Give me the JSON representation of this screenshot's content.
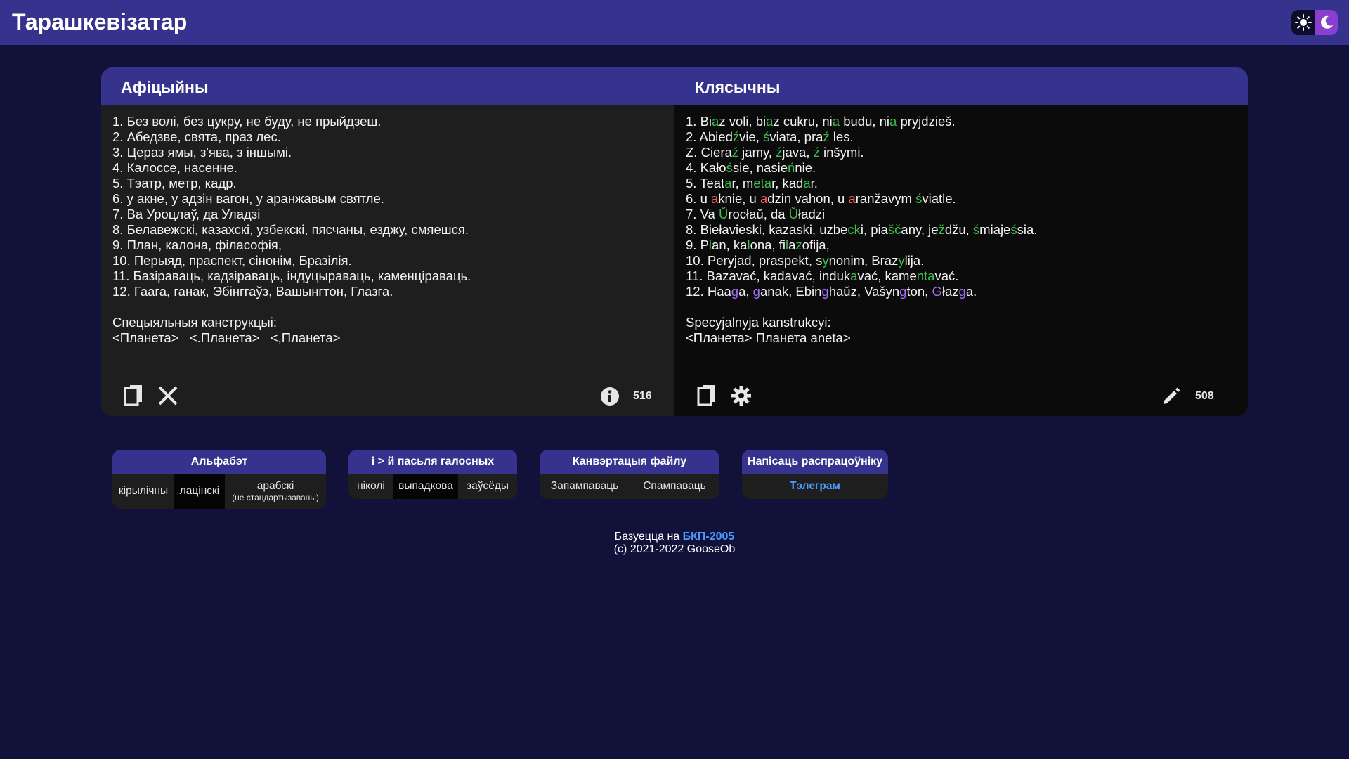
{
  "header": {
    "title": "Тарашкевізатар",
    "theme_toggle_icons": [
      "sun-icon",
      "moon-icon"
    ]
  },
  "official": {
    "title": "Афіцыйны",
    "lines": [
      "1. Без волі, без цукру, не буду, не прыйдзеш.",
      "2. Абедзве, свята, праз лес.",
      "3. Цераз ямы, з'ява, з іншымі.",
      "4. Калоссе, насенне.",
      "5. Тэатр, метр, кадр.",
      "6. у акне, у адзін вагон, у аранжавым святле.",
      "7. Ва Уроцлаў, да Уладзі",
      "8. Белавежскі, казахскі, узбекскі, пясчаны, езджу, смяешся.",
      "9. План, калона, філасофія,",
      "10. Перыяд, праспект, сінонім, Бразілія.",
      "11. Базіраваць, кадзіраваць, індуцыраваць, каменціраваць.",
      "12. Гаага, ганак, Эбінггаўз, Вашынгтон, Глазга.",
      "",
      "Спецыяльныя канструкцыі:",
      "<Планета>   <.Планета>   <,Планета>"
    ],
    "count": "516"
  },
  "classic": {
    "title": "Клясычны",
    "lines": [
      [
        [
          "1. Bi",
          ""
        ],
        [
          "a",
          "g"
        ],
        [
          "z voli, bi",
          ""
        ],
        [
          "a",
          "g"
        ],
        [
          "z cukru, ni",
          ""
        ],
        [
          "a",
          "g"
        ],
        [
          " budu, ni",
          ""
        ],
        [
          "a",
          "g"
        ],
        [
          " pryjdzieš.",
          ""
        ]
      ],
      [
        [
          "2. Abied",
          ""
        ],
        [
          "ź",
          "g"
        ],
        [
          "vie, ",
          ""
        ],
        [
          "ś",
          "g"
        ],
        [
          "viata, pra",
          ""
        ],
        [
          "ź",
          "g"
        ],
        [
          " les.",
          ""
        ]
      ],
      [
        [
          "Z. Ciera",
          ""
        ],
        [
          "ź",
          "g"
        ],
        [
          " jamy, ",
          ""
        ],
        [
          "ź",
          "g"
        ],
        [
          "java, ",
          ""
        ],
        [
          "ź",
          "g"
        ],
        [
          " inšymi.",
          ""
        ]
      ],
      [
        [
          "4. Kało",
          ""
        ],
        [
          "ś",
          "g"
        ],
        [
          "sie, nasie",
          ""
        ],
        [
          "ń",
          "g"
        ],
        [
          "nie.",
          ""
        ]
      ],
      [
        [
          "5. Teat",
          ""
        ],
        [
          "a",
          "g"
        ],
        [
          "r, m",
          ""
        ],
        [
          "eta",
          "g"
        ],
        [
          "r, kad",
          ""
        ],
        [
          "a",
          "g"
        ],
        [
          "r.",
          ""
        ]
      ],
      [
        [
          "6. u ",
          ""
        ],
        [
          "a",
          "r"
        ],
        [
          "knie, u ",
          ""
        ],
        [
          "a",
          "r"
        ],
        [
          "dzin vahon, u ",
          ""
        ],
        [
          "a",
          "r"
        ],
        [
          "ranžavym ",
          ""
        ],
        [
          "ś",
          "g"
        ],
        [
          "viatle.",
          ""
        ]
      ],
      [
        [
          "7. Va ",
          ""
        ],
        [
          "Ŭ",
          "g"
        ],
        [
          "rocłaŭ, da ",
          ""
        ],
        [
          "Ŭ",
          "g"
        ],
        [
          "ładzi",
          ""
        ]
      ],
      [
        [
          "8. Biełavieski, kazaski, uzbe",
          ""
        ],
        [
          "ck",
          "g"
        ],
        [
          "i, pia",
          ""
        ],
        [
          "šč",
          "g"
        ],
        [
          "any, je",
          ""
        ],
        [
          "ž",
          "g"
        ],
        [
          "džu, ",
          ""
        ],
        [
          "ś",
          "g"
        ],
        [
          "miaje",
          ""
        ],
        [
          "ś",
          "g"
        ],
        [
          "sia.",
          ""
        ]
      ],
      [
        [
          "9. P",
          ""
        ],
        [
          "l",
          "g"
        ],
        [
          "an, ka",
          ""
        ],
        [
          "l",
          "g"
        ],
        [
          "ona, fi",
          ""
        ],
        [
          "l",
          "g"
        ],
        [
          "a",
          ""
        ],
        [
          "z",
          "g"
        ],
        [
          "ofija,",
          ""
        ]
      ],
      [
        [
          "10. Peryjad, praspekt, s",
          ""
        ],
        [
          "y",
          "g"
        ],
        [
          "nonim, Braz",
          ""
        ],
        [
          "y",
          "g"
        ],
        [
          "lija.",
          ""
        ]
      ],
      [
        [
          "11. Bazavać, kadavać, induk",
          ""
        ],
        [
          "a",
          "g"
        ],
        [
          "vać, kame",
          ""
        ],
        [
          "nta",
          "g"
        ],
        [
          "vać.",
          ""
        ]
      ],
      [
        [
          "12. Haa",
          ""
        ],
        [
          "g",
          "p"
        ],
        [
          "a, ",
          ""
        ],
        [
          "g",
          "p"
        ],
        [
          "anak, Ebin",
          ""
        ],
        [
          "g",
          "p"
        ],
        [
          "haŭz, Vašyn",
          ""
        ],
        [
          "g",
          "p"
        ],
        [
          "ton, ",
          ""
        ],
        [
          "G",
          "p"
        ],
        [
          "łaz",
          ""
        ],
        [
          "g",
          "p"
        ],
        [
          "a.",
          ""
        ]
      ],
      [
        [
          "",
          ""
        ]
      ],
      [
        [
          "Specyjalnyja kanstrukcyi:",
          ""
        ]
      ],
      [
        [
          "<Планета> Планета aneta>",
          ""
        ]
      ]
    ],
    "count": "508"
  },
  "options": {
    "alphabet": {
      "title": "Альфабэт",
      "items": [
        "кірылічны",
        "лацінскі"
      ],
      "arabic": "арабскі",
      "arabic_note": "(не стандартызаваны)",
      "selected": "лацінскі"
    },
    "i_to_j": {
      "title": "і > й пасьля галосных",
      "items": [
        "ніколі",
        "выпадкова",
        "заўсёды"
      ],
      "selected": "выпадкова"
    },
    "file_conv": {
      "title": "Канвэртацыя файлу",
      "items": [
        "Запампаваць",
        "Спампаваць"
      ]
    },
    "contact": {
      "title": "Напісаць распрацоўніку",
      "link": "Тэлеграм"
    }
  },
  "footer": {
    "based_on": "Базуецца на",
    "link": "БКП-2005",
    "copyright": "(c) 2021-2022 GooseOb"
  },
  "colors": {
    "header": "#35338e",
    "background": "#12113a",
    "pane_left": "#1e1e1e",
    "pane_right": "#0b0b0b",
    "highlight_green": "#3bbf4a",
    "highlight_red": "#ff5a5a",
    "highlight_purple": "#a76cff",
    "link": "#4a9cff"
  }
}
